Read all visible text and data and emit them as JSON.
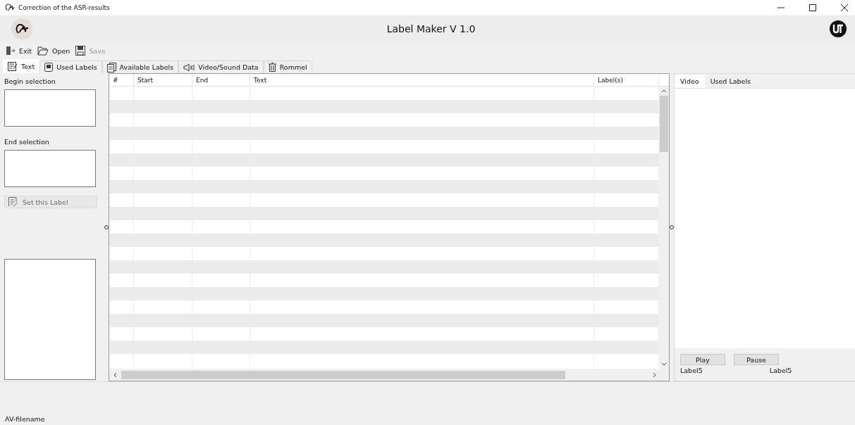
{
  "window": {
    "title": "Correction of the ASR-results"
  },
  "header": {
    "title": "Label Maker V 1.0"
  },
  "toolbar": [
    {
      "kind": "exit",
      "label": "Exit",
      "disabled": false
    },
    {
      "kind": "open",
      "label": "Open",
      "disabled": false
    },
    {
      "kind": "save",
      "label": "Save",
      "disabled": true
    }
  ],
  "tabs": [
    {
      "kind": "text",
      "label": "Text",
      "selected": true
    },
    {
      "kind": "labels",
      "label": "Used Labels",
      "selected": false
    },
    {
      "kind": "available",
      "label": "Available Labels",
      "selected": false
    },
    {
      "kind": "media",
      "label": "Video/Sound Data",
      "selected": false
    },
    {
      "kind": "trash",
      "label": "Rommel",
      "selected": false
    }
  ],
  "left_panel": {
    "begin_label": "Begin selection",
    "end_label": "End selection",
    "set_button": {
      "label": "Set this Label",
      "disabled": true
    }
  },
  "table": {
    "columns": [
      "#",
      "Start",
      "End",
      "Text",
      "Label(s)"
    ]
  },
  "right_panel": {
    "tabs": [
      {
        "label": "Video",
        "selected": true
      },
      {
        "label": "Used Labels",
        "selected": false
      }
    ],
    "buttons": [
      "Play",
      "Pause"
    ],
    "labels": [
      "Label5",
      "Label5"
    ]
  },
  "status_bar": {
    "text": "AV-filename"
  }
}
